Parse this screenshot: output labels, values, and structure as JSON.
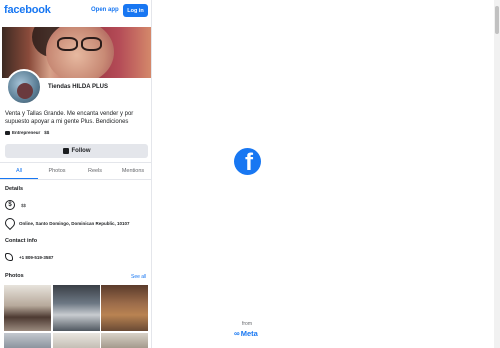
{
  "header": {
    "logo": "facebook",
    "open_app": "Open app",
    "login": "Log in"
  },
  "profile": {
    "name": "Tiendas HILDA PLUS",
    "bio": "Venta y Tallas Grande. Me encanta vender y por supuesto apoyar a mi gente Plus. Bendiciones",
    "category": "Entrepreneur",
    "price": "$$",
    "follow": "Follow"
  },
  "tabs": [
    {
      "label": "All",
      "active": true
    },
    {
      "label": "Photos",
      "active": false
    },
    {
      "label": "Reels",
      "active": false
    },
    {
      "label": "Mentions",
      "active": false
    }
  ],
  "details": {
    "title": "Details",
    "price": "$$",
    "location": "Online, Santo Domingo, Dominican Republic, 10107"
  },
  "contact": {
    "title": "Contact info",
    "phone": "+1 809-519-3587"
  },
  "photos": {
    "title": "Photos",
    "see_all": "See all"
  },
  "splash": {
    "from": "from",
    "brand": "Meta",
    "brand_symbol": "∞"
  },
  "colors": {
    "accent": "#1877f2",
    "text": "#1c1e21",
    "muted": "#65676b",
    "button_bg": "#e4e6eb"
  },
  "icons": [
    "facebook-logo-icon",
    "briefcase-icon",
    "follow-icon",
    "money-icon",
    "location-pin-icon",
    "phone-icon",
    "meta-logo-icon"
  ]
}
